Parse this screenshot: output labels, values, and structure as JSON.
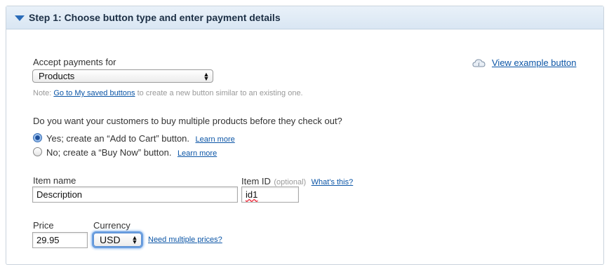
{
  "step": {
    "title": "Step 1: Choose button type and enter payment details"
  },
  "accept": {
    "label": "Accept payments for",
    "selected": "Products"
  },
  "view_example": {
    "label": "View example button"
  },
  "note": {
    "prefix": "Note:",
    "link": "Go to My saved buttons",
    "suffix": "to create a new button similar to an existing one."
  },
  "multiple": {
    "question": "Do you want your customers to buy multiple products before they check out?",
    "options": [
      {
        "label": "Yes; create an “Add to Cart” button.",
        "learn": "Learn more",
        "checked": true
      },
      {
        "label": "No; create a “Buy Now” button.",
        "learn": "Learn more",
        "checked": false
      }
    ]
  },
  "item_name": {
    "label": "Item name",
    "value": "Description"
  },
  "item_id": {
    "label": "Item ID",
    "optional": "(optional)",
    "help": "What's this?",
    "value": "id1"
  },
  "price": {
    "label": "Price",
    "value": "29.95"
  },
  "currency": {
    "label": "Currency",
    "selected": "USD",
    "help": "Need multiple prices?"
  },
  "colors": {
    "link": "#0b55a6",
    "header_bg": "#d9e6f3",
    "accent": "#2a6bb8"
  }
}
